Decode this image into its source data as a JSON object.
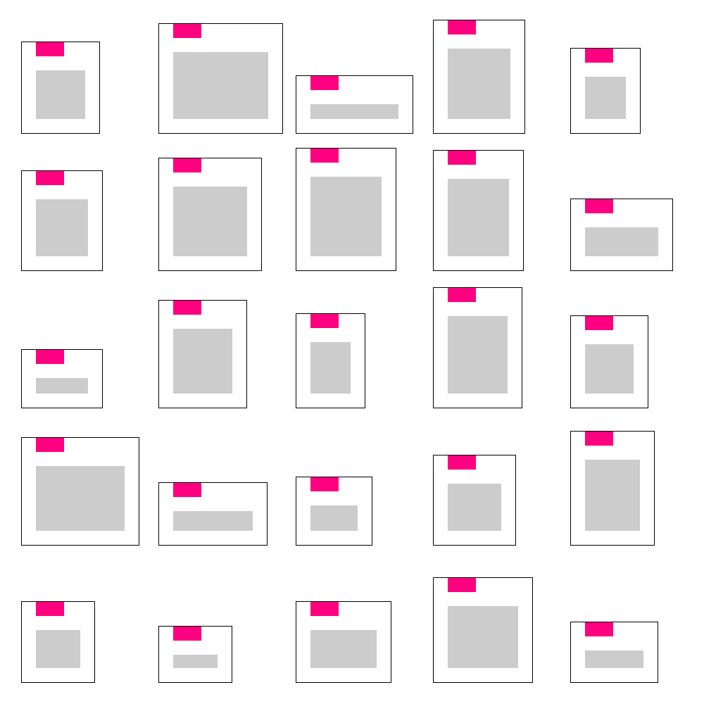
{
  "colors": {
    "card_border": "#000000",
    "card_background": "#ffffff",
    "tag_accent": "#ff0080",
    "placeholder_fill": "#cccccc"
  },
  "grid": {
    "columns": 5,
    "rows": 5,
    "card_count": 25
  }
}
